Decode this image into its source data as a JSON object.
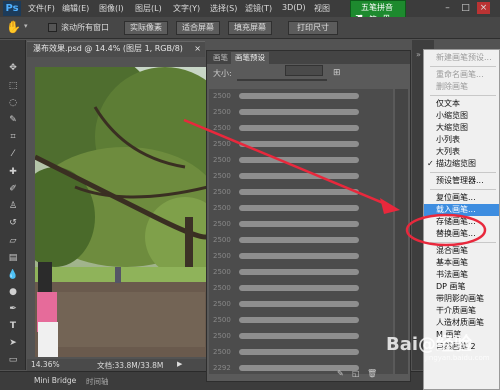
{
  "menubar": {
    "logo": "Ps",
    "items": [
      "文件(F)",
      "编辑(E)",
      "图像(I)",
      "图层(L)",
      "文字(Y)",
      "选择(S)",
      "滤镜(T)",
      "3D(D)",
      "视图"
    ],
    "window_controls": [
      "–",
      "□",
      "×"
    ]
  },
  "ime": {
    "title": "五笔拼音",
    "mode": "简",
    "extra": "⊞"
  },
  "options": {
    "scroll_all_label": "滚动所有窗口",
    "buttons": [
      "实际像素",
      "适合屏幕",
      "填充屏幕",
      "打印尺寸"
    ]
  },
  "document": {
    "tab_title": "瀑布效果.psd @ 14.4% (图层 1, RGB/8)",
    "zoom": "14.36%",
    "doc_size": "文档:33.8M/33.8M"
  },
  "bottom_tabs": [
    "Mini Bridge",
    "时间轴"
  ],
  "brush_panel": {
    "tabs": [
      "画笔",
      "画笔预设"
    ],
    "size_label": "大小:",
    "sizes": [
      "2500",
      "2500",
      "2500",
      "2500",
      "2500",
      "2500",
      "2500",
      "2500",
      "2500",
      "2500",
      "2500",
      "2500",
      "2500",
      "2500",
      "2500",
      "2500",
      "2500",
      "2292"
    ]
  },
  "context_menu": {
    "items": [
      {
        "label": "新建画笔预设...",
        "disabled": true
      },
      {
        "sep": true
      },
      {
        "label": "重命名画笔...",
        "disabled": true
      },
      {
        "label": "删除画笔",
        "disabled": true
      },
      {
        "sep": true
      },
      {
        "label": "仅文本"
      },
      {
        "label": "小缩览图"
      },
      {
        "label": "大缩览图"
      },
      {
        "label": "小列表"
      },
      {
        "label": "大列表"
      },
      {
        "label": "描边缩览图",
        "checked": true
      },
      {
        "sep": true
      },
      {
        "label": "预设管理器..."
      },
      {
        "sep": true
      },
      {
        "label": "复位画笔..."
      },
      {
        "label": "载入画笔...",
        "highlight": true
      },
      {
        "label": "存储画笔..."
      },
      {
        "label": "替换画笔..."
      },
      {
        "sep": true
      },
      {
        "label": "混合画笔"
      },
      {
        "label": "基本画笔"
      },
      {
        "label": "书法画笔"
      },
      {
        "label": "DP 画笔"
      },
      {
        "label": "带阴影的画笔"
      },
      {
        "label": "干介质画笔"
      },
      {
        "label": "人造材质画笔"
      },
      {
        "label": "M 画笔"
      },
      {
        "label": "自然画笔 2"
      }
    ]
  },
  "watermark": {
    "text": "Bai@经验",
    "url": "jingyan.baidu.com"
  },
  "colors": {
    "accent": "#3d8de0",
    "annotation": "#e8283c",
    "ime_bg": "#1d8a2e"
  }
}
